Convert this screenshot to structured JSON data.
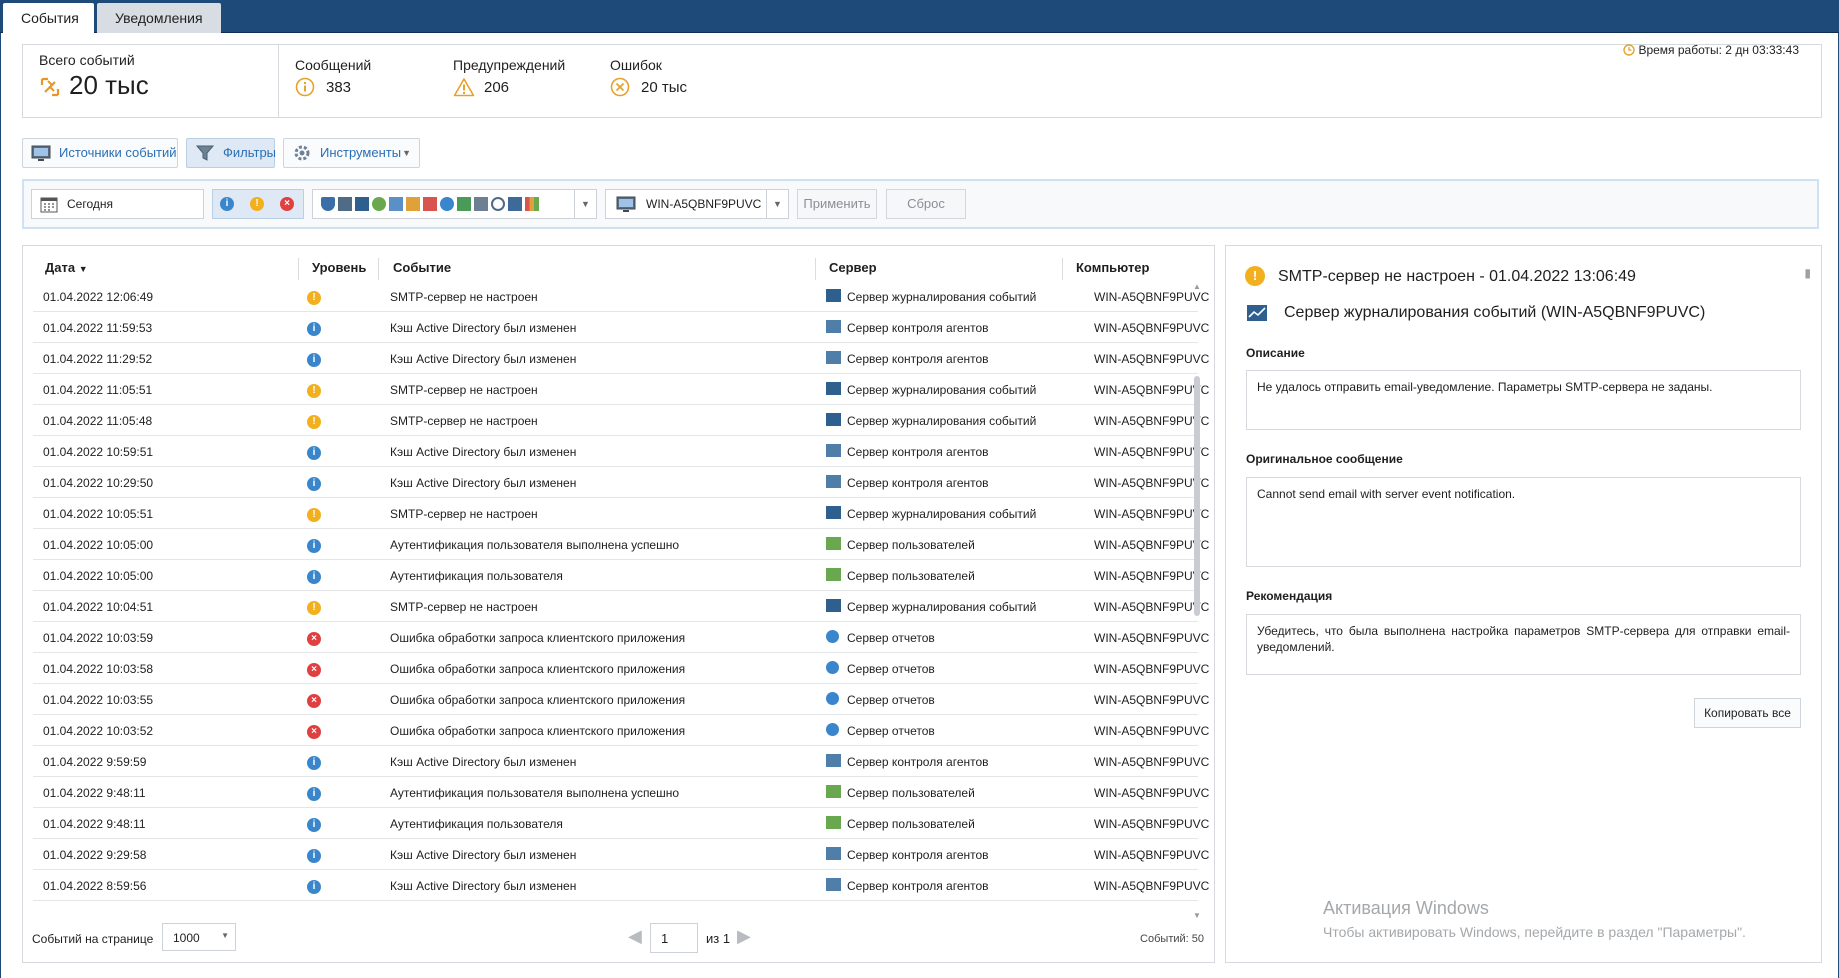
{
  "tabs": {
    "events": "События",
    "notifications": "Уведомления"
  },
  "stats": {
    "total_label": "Всего событий",
    "total_value": "20 тыс",
    "messages_label": "Сообщений",
    "messages_value": "383",
    "warnings_label": "Предупреждений",
    "warnings_value": "206",
    "errors_label": "Ошибок",
    "errors_value": "20 тыс",
    "uptime": "Время работы: 2 дн 03:33:43"
  },
  "toolbar": {
    "sources": "Источники событий",
    "filters": "Фильтры",
    "tools": "Инструменты"
  },
  "filter": {
    "date": "Сегодня",
    "computer": "WIN-A5QBNF9PUVC",
    "apply": "Применить",
    "reset": "Сброс"
  },
  "columns": {
    "date": "Дата",
    "level": "Уровень",
    "event": "Событие",
    "server": "Сервер",
    "computer": "Компьютер"
  },
  "rows": [
    {
      "date": "01.04.2022 12:06:49",
      "level": "warn",
      "event": "SMTP-сервер не настроен",
      "server": "Сервер журналирования событий",
      "host": "WIN-A5QBNF9PUVC",
      "srv": "log"
    },
    {
      "date": "01.04.2022 11:59:53",
      "level": "info",
      "event": "Кэш Active Directory был изменен",
      "server": "Сервер контроля агентов",
      "host": "WIN-A5QBNF9PUVC",
      "srv": "agent"
    },
    {
      "date": "01.04.2022 11:29:52",
      "level": "info",
      "event": "Кэш Active Directory был изменен",
      "server": "Сервер контроля агентов",
      "host": "WIN-A5QBNF9PUVC",
      "srv": "agent"
    },
    {
      "date": "01.04.2022 11:05:51",
      "level": "warn",
      "event": "SMTP-сервер не настроен",
      "server": "Сервер журналирования событий",
      "host": "WIN-A5QBNF9PUVC",
      "srv": "log"
    },
    {
      "date": "01.04.2022 11:05:48",
      "level": "warn",
      "event": "SMTP-сервер не настроен",
      "server": "Сервер журналирования событий",
      "host": "WIN-A5QBNF9PUVC",
      "srv": "log"
    },
    {
      "date": "01.04.2022 10:59:51",
      "level": "info",
      "event": "Кэш Active Directory был изменен",
      "server": "Сервер контроля агентов",
      "host": "WIN-A5QBNF9PUVC",
      "srv": "agent"
    },
    {
      "date": "01.04.2022 10:29:50",
      "level": "info",
      "event": "Кэш Active Directory был изменен",
      "server": "Сервер контроля агентов",
      "host": "WIN-A5QBNF9PUVC",
      "srv": "agent"
    },
    {
      "date": "01.04.2022 10:05:51",
      "level": "warn",
      "event": "SMTP-сервер не настроен",
      "server": "Сервер журналирования событий",
      "host": "WIN-A5QBNF9PUVC",
      "srv": "log"
    },
    {
      "date": "01.04.2022 10:05:00",
      "level": "info",
      "event": "Аутентификация пользователя выполнена успешно",
      "server": "Сервер пользователей",
      "host": "WIN-A5QBNF9PUVC",
      "srv": "users"
    },
    {
      "date": "01.04.2022 10:05:00",
      "level": "info",
      "event": "Аутентификация пользователя",
      "server": "Сервер пользователей",
      "host": "WIN-A5QBNF9PUVC",
      "srv": "users"
    },
    {
      "date": "01.04.2022 10:04:51",
      "level": "warn",
      "event": "SMTP-сервер не настроен",
      "server": "Сервер журналирования событий",
      "host": "WIN-A5QBNF9PUVC",
      "srv": "log"
    },
    {
      "date": "01.04.2022 10:03:59",
      "level": "err",
      "event": "Ошибка обработки запроса клиентского приложения",
      "server": "Сервер отчетов",
      "host": "WIN-A5QBNF9PUVC",
      "srv": "reports"
    },
    {
      "date": "01.04.2022 10:03:58",
      "level": "err",
      "event": "Ошибка обработки запроса клиентского приложения",
      "server": "Сервер отчетов",
      "host": "WIN-A5QBNF9PUVC",
      "srv": "reports"
    },
    {
      "date": "01.04.2022 10:03:55",
      "level": "err",
      "event": "Ошибка обработки запроса клиентского приложения",
      "server": "Сервер отчетов",
      "host": "WIN-A5QBNF9PUVC",
      "srv": "reports"
    },
    {
      "date": "01.04.2022 10:03:52",
      "level": "err",
      "event": "Ошибка обработки запроса клиентского приложения",
      "server": "Сервер отчетов",
      "host": "WIN-A5QBNF9PUVC",
      "srv": "reports"
    },
    {
      "date": "01.04.2022 9:59:59",
      "level": "info",
      "event": "Кэш Active Directory был изменен",
      "server": "Сервер контроля агентов",
      "host": "WIN-A5QBNF9PUVC",
      "srv": "agent"
    },
    {
      "date": "01.04.2022 9:48:11",
      "level": "info",
      "event": "Аутентификация пользователя выполнена успешно",
      "server": "Сервер пользователей",
      "host": "WIN-A5QBNF9PUVC",
      "srv": "users"
    },
    {
      "date": "01.04.2022 9:48:11",
      "level": "info",
      "event": "Аутентификация пользователя",
      "server": "Сервер пользователей",
      "host": "WIN-A5QBNF9PUVC",
      "srv": "users"
    },
    {
      "date": "01.04.2022 9:29:58",
      "level": "info",
      "event": "Кэш Active Directory был изменен",
      "server": "Сервер контроля агентов",
      "host": "WIN-A5QBNF9PUVC",
      "srv": "agent"
    },
    {
      "date": "01.04.2022 8:59:56",
      "level": "info",
      "event": "Кэш Active Directory был изменен",
      "server": "Сервер контроля агентов",
      "host": "WIN-A5QBNF9PUVC",
      "srv": "agent"
    }
  ],
  "pager": {
    "per_page_label": "Событий на странице",
    "per_page_value": "1000",
    "page": "1",
    "of": "из 1",
    "count": "Событий: 50"
  },
  "detail": {
    "title": "SMTP-сервер не настроен - 01.04.2022 13:06:49",
    "subtitle": "Сервер журналирования событий (WIN-A5QBNF9PUVC)",
    "desc_label": "Описание",
    "desc_text": "Не удалось отправить email-уведомление. Параметры SMTP-сервера не заданы.",
    "orig_label": "Оригинальное сообщение",
    "orig_text": "Cannot send email with server event notification.",
    "rec_label": "Рекомендация",
    "rec_text": "Убедитесь, что была выполнена настройка параметров SMTP-сервера для отправки email-уведомлений.",
    "copy": "Копировать все"
  },
  "watermark": {
    "line1": "Активация Windows",
    "line2": "Чтобы активировать Windows, перейдите в раздел \"Параметры\"."
  },
  "colors": {
    "accent": "#2a6fb5",
    "tabbar": "#1e4a7a",
    "info": "#3a86cc",
    "warn": "#f2b01e",
    "error": "#e04040"
  }
}
